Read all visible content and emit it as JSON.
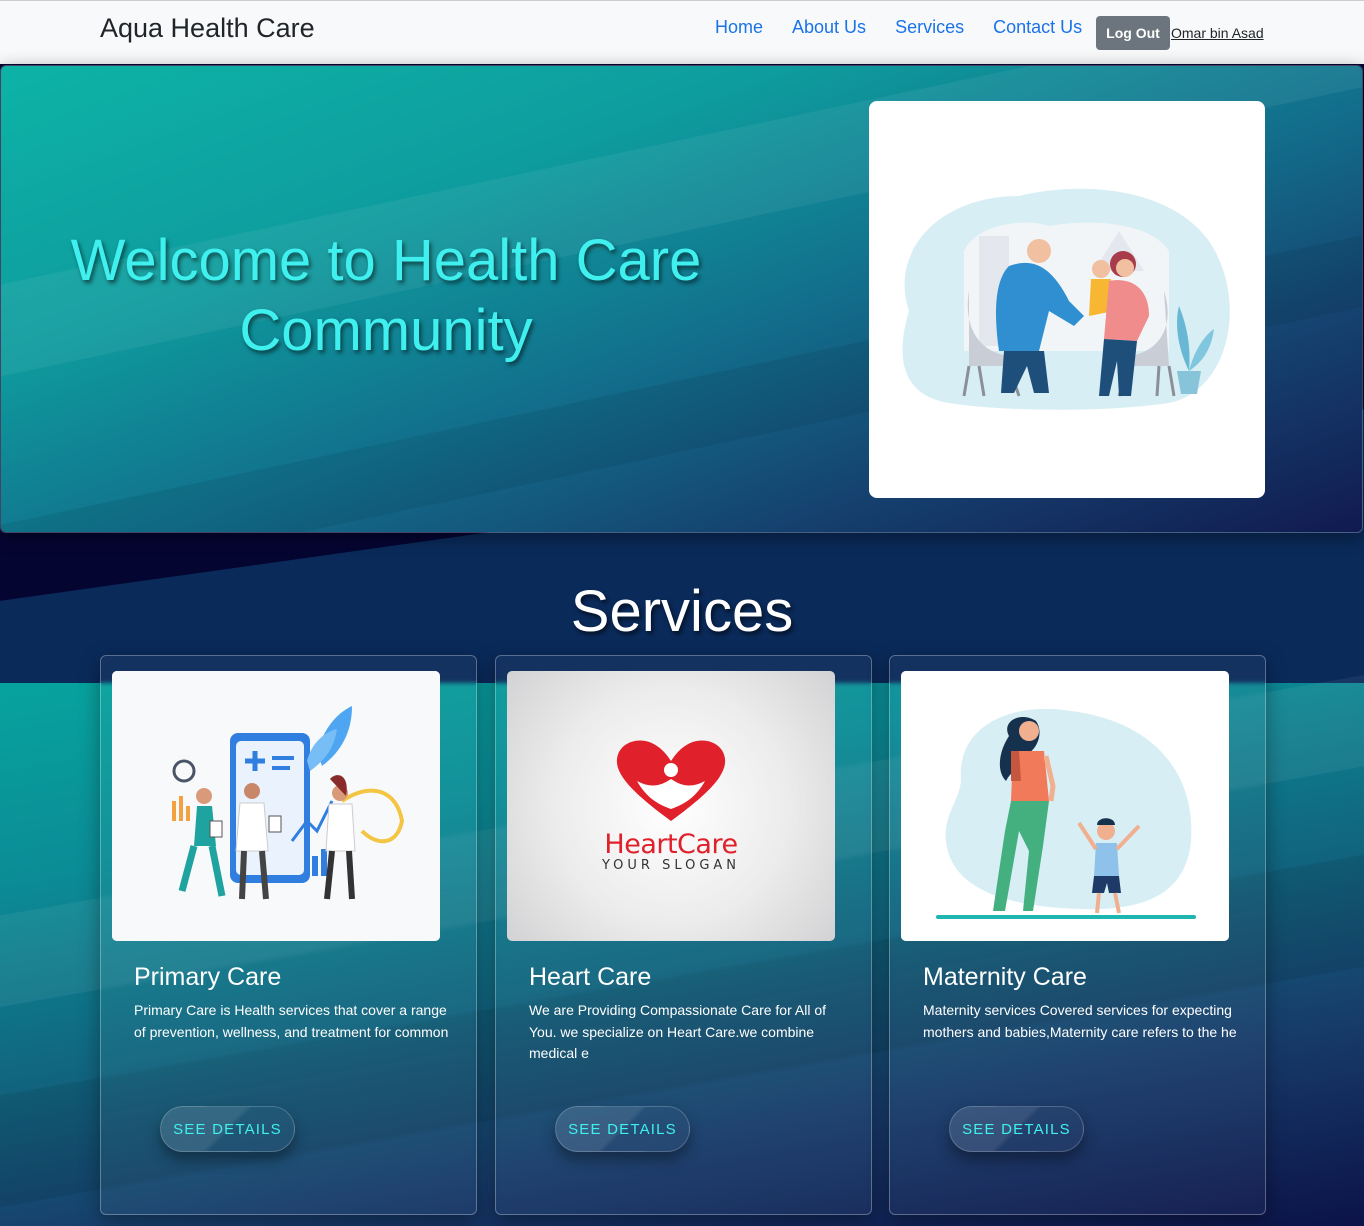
{
  "navbar": {
    "brand": "Aqua Health Care",
    "links": [
      "Home",
      "About Us",
      "Services",
      "Contact Us"
    ],
    "logout_label": "Log Out",
    "user_name": "Omar bin Asad"
  },
  "hero": {
    "title_line1": "Welcome to Health Care",
    "title_line2": "Community",
    "image_icon": "doctor-consultation-illustration"
  },
  "services": {
    "heading": "Services",
    "cards": [
      {
        "title": "Primary Care",
        "text": "Primary Care is Health services that cover a range of prevention, wellness, and treatment for common",
        "button": "See Details",
        "image_icon": "primary-care-illustration"
      },
      {
        "title": "Heart Care",
        "text": "We are Providing Compassionate Care for All of You. we specialize on Heart Care.we combine medical e",
        "button": "See Details",
        "image_icon": "heartcare-logo",
        "logo_text": "HeartCare",
        "logo_slogan": "YOUR SLOGAN"
      },
      {
        "title": "Maternity Care",
        "text": "Maternity services Covered services for expecting mothers and babies,Maternity care refers to the he",
        "button": "See Details",
        "image_icon": "mother-child-illustration"
      }
    ]
  },
  "colors": {
    "accent_cyan": "#3ff0ee",
    "nav_link": "#1a73e8",
    "dark_navy": "#050532",
    "teal": "#0db3a6"
  }
}
